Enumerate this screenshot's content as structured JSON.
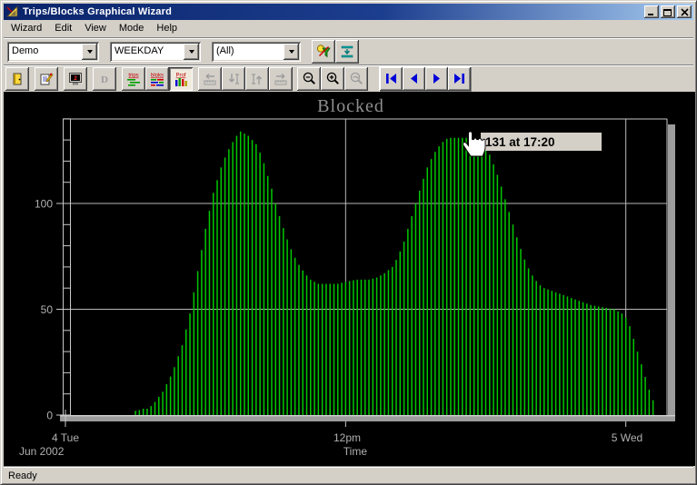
{
  "window": {
    "title": "Trips/Blocks Graphical Wizard",
    "status": "Ready"
  },
  "menu": {
    "items": [
      "Wizard",
      "Edit",
      "View",
      "Mode",
      "Help"
    ]
  },
  "filters": {
    "dataset": "Demo",
    "day_type": "WEEKDAY",
    "route_filter": "(All)"
  },
  "toolbar": {
    "d_label": "D",
    "trips_label": "trips",
    "blocks_label": "bloks",
    "profile_label": "Prof"
  },
  "chart": {
    "title": "Blocked",
    "x_axis_label": "Time",
    "x_tick_start": "4 Tue",
    "x_tick_mid": "12pm",
    "x_tick_end": "5 Wed",
    "month_label": "Jun 2002",
    "tooltip_text": "131 at 17:20",
    "colors": {
      "bar": "#00c800",
      "grid": "#b9b9b9",
      "axis": "#c8c8c8",
      "label": "#b0b0b0",
      "title": "#8f8f8f",
      "background": "#000000",
      "tooltip_bg": "#d4d0c8"
    }
  },
  "chart_data": {
    "type": "bar",
    "title": "Blocked",
    "xlabel": "Time",
    "ylabel": "",
    "x_tick_labels": [
      "4 Tue",
      "12pm",
      "5 Wed"
    ],
    "x_tick_minutes": [
      0,
      720,
      1440
    ],
    "month_label": "Jun 2002",
    "y_ticks": [
      0,
      50,
      100
    ],
    "y_minor_step": 10,
    "y_axis_max": 140,
    "bar_interval_minutes": 10,
    "bars_start_minute": 180,
    "bars_end_minute": 1510,
    "highlight": {
      "value": 131,
      "time": "17:20",
      "minute": 1040
    },
    "envelope_points": [
      [
        185,
        2
      ],
      [
        200,
        3
      ],
      [
        212,
        3
      ],
      [
        225,
        5
      ],
      [
        250,
        11
      ],
      [
        275,
        20
      ],
      [
        300,
        33
      ],
      [
        320,
        48
      ],
      [
        340,
        68
      ],
      [
        360,
        88
      ],
      [
        380,
        105
      ],
      [
        400,
        117
      ],
      [
        415,
        124
      ],
      [
        430,
        129
      ],
      [
        440,
        132
      ],
      [
        450,
        134
      ],
      [
        460,
        133
      ],
      [
        470,
        132
      ],
      [
        480,
        130
      ],
      [
        490,
        128
      ],
      [
        500,
        124
      ],
      [
        510,
        119
      ],
      [
        520,
        113
      ],
      [
        530,
        107
      ],
      [
        540,
        100
      ],
      [
        555,
        91
      ],
      [
        570,
        83
      ],
      [
        585,
        76
      ],
      [
        600,
        71
      ],
      [
        615,
        67
      ],
      [
        630,
        64
      ],
      [
        650,
        62
      ],
      [
        680,
        62
      ],
      [
        700,
        62
      ],
      [
        720,
        63
      ],
      [
        750,
        64
      ],
      [
        780,
        64
      ],
      [
        800,
        65
      ],
      [
        820,
        67
      ],
      [
        840,
        70
      ],
      [
        855,
        75
      ],
      [
        870,
        82
      ],
      [
        885,
        91
      ],
      [
        900,
        100
      ],
      [
        915,
        109
      ],
      [
        930,
        117
      ],
      [
        945,
        123
      ],
      [
        960,
        127
      ],
      [
        975,
        130
      ],
      [
        985,
        131
      ],
      [
        1040,
        131
      ],
      [
        1055,
        130
      ],
      [
        1070,
        128
      ],
      [
        1085,
        125
      ],
      [
        1095,
        121
      ],
      [
        1105,
        116
      ],
      [
        1115,
        111
      ],
      [
        1125,
        105
      ],
      [
        1135,
        99
      ],
      [
        1145,
        93
      ],
      [
        1155,
        87
      ],
      [
        1165,
        81
      ],
      [
        1175,
        76
      ],
      [
        1185,
        71
      ],
      [
        1200,
        66
      ],
      [
        1215,
        62
      ],
      [
        1230,
        60
      ],
      [
        1260,
        58
      ],
      [
        1290,
        56
      ],
      [
        1320,
        54
      ],
      [
        1350,
        52
      ],
      [
        1380,
        51
      ],
      [
        1410,
        50
      ],
      [
        1430,
        48
      ],
      [
        1440,
        46
      ],
      [
        1450,
        42
      ],
      [
        1460,
        36
      ],
      [
        1470,
        30
      ],
      [
        1480,
        24
      ],
      [
        1490,
        18
      ],
      [
        1500,
        12
      ],
      [
        1510,
        7
      ]
    ]
  }
}
